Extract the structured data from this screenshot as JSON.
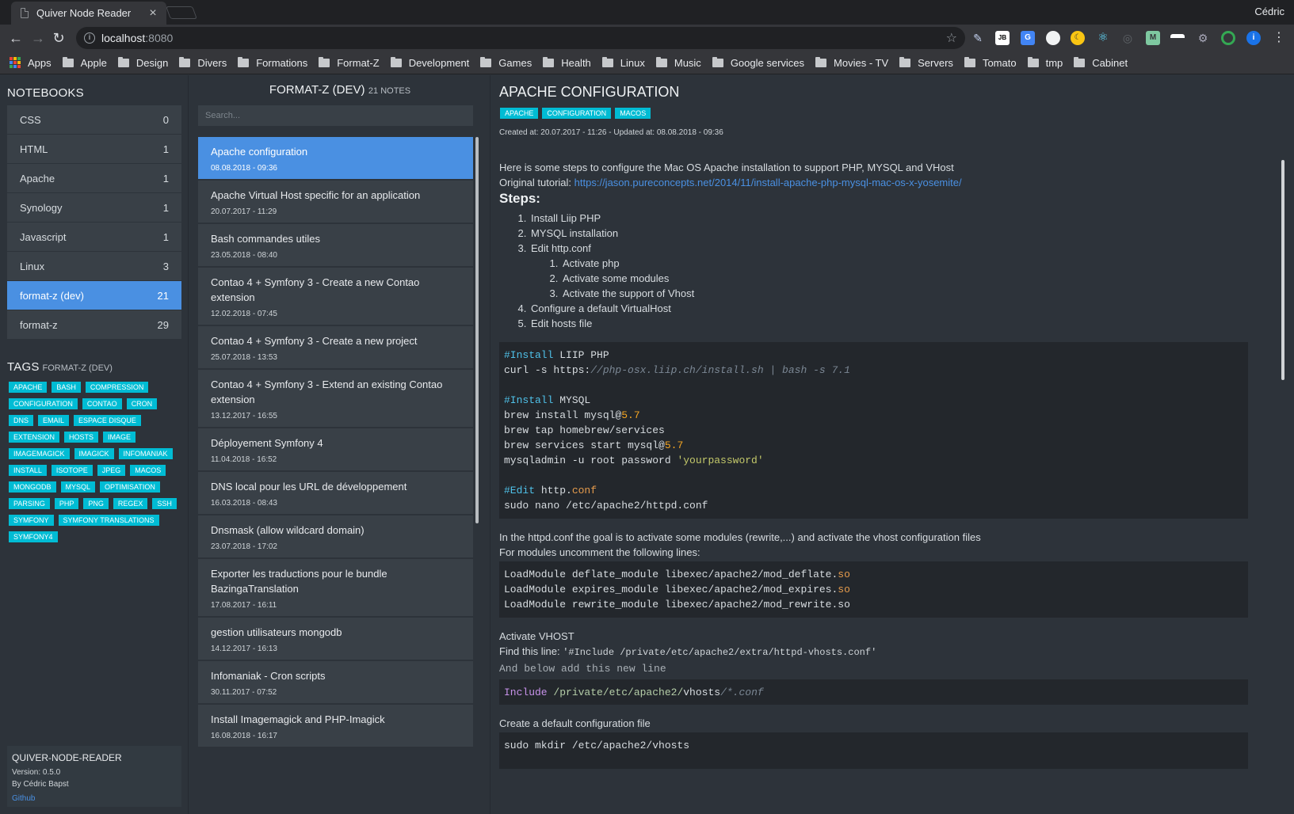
{
  "browser": {
    "tab_title": "Quiver Node Reader",
    "tab_close": "×",
    "profile": "Cédric",
    "url_host": "localhost",
    "url_port": ":8080",
    "bookmarks": [
      "Apps",
      "Apple",
      "Design",
      "Divers",
      "Formations",
      "Format-Z",
      "Development",
      "Games",
      "Health",
      "Linux",
      "Music",
      "Google services",
      "Movies - TV",
      "Servers",
      "Tomato",
      "tmp",
      "Cabinet"
    ],
    "extension_icons": [
      "brush-icon",
      "jetbrains-icon",
      "translate-icon",
      "circle-icon",
      "moon-icon",
      "react-icon",
      "disabled-icon",
      "mail-icon",
      "flag-icon",
      "puzzle-icon",
      "target-icon",
      "password-icon"
    ]
  },
  "sidebar": {
    "notebooks_title": "NOTEBOOKS",
    "notebooks": [
      {
        "label": "CSS",
        "count": "0"
      },
      {
        "label": "HTML",
        "count": "1"
      },
      {
        "label": "Apache",
        "count": "1"
      },
      {
        "label": "Synology",
        "count": "1"
      },
      {
        "label": "Javascript",
        "count": "1"
      },
      {
        "label": "Linux",
        "count": "3"
      },
      {
        "label": "format-z (dev)",
        "count": "21"
      },
      {
        "label": "format-z",
        "count": "29"
      }
    ],
    "active_notebook": "format-z (dev)",
    "tags_title": "TAGS",
    "tags_sub": "FORMAT-Z (DEV)",
    "tags": [
      "APACHE",
      "BASH",
      "COMPRESSION",
      "CONFIGURATION",
      "CONTAO",
      "CRON",
      "DNS",
      "EMAIL",
      "ESPACE DISQUE",
      "EXTENSION",
      "HOSTS",
      "IMAGE",
      "IMAGEMAGICK",
      "IMAGICK",
      "INFOMANIAK",
      "INSTALL",
      "ISOTOPE",
      "JPEG",
      "MACOS",
      "MONGODB",
      "MYSQL",
      "OPTIMISATION",
      "PARSING",
      "PHP",
      "PNG",
      "REGEX",
      "SSH",
      "SYMFONY",
      "SYMFONY TRANSLATIONS",
      "SYMFONY4"
    ],
    "about": {
      "title": "QUIVER-NODE-READER",
      "version": "Version: 0.5.0",
      "author": "By Cédric Bapst",
      "link": "Github"
    }
  },
  "notes_panel": {
    "title": "FORMAT-Z (DEV)",
    "count": "21 NOTES",
    "search_placeholder": "Search...",
    "notes": [
      {
        "title": "Apache configuration",
        "date": "08.08.2018 - 09:36"
      },
      {
        "title": "Apache Virtual Host specific for an application",
        "date": "20.07.2017 - 11:29"
      },
      {
        "title": "Bash commandes utiles",
        "date": "23.05.2018 - 08:40"
      },
      {
        "title": "Contao 4 + Symfony 3 - Create a new Contao extension",
        "date": "12.02.2018 - 07:45"
      },
      {
        "title": "Contao 4 + Symfony 3 - Create a new project",
        "date": "25.07.2018 - 13:53"
      },
      {
        "title": "Contao 4 + Symfony 3 - Extend an existing Contao extension",
        "date": "13.12.2017 - 16:55"
      },
      {
        "title": "Déployement Symfony 4",
        "date": "11.04.2018 - 16:52"
      },
      {
        "title": "DNS local pour les URL de développement",
        "date": "16.03.2018 - 08:43"
      },
      {
        "title": "Dnsmask (allow wildcard domain)",
        "date": "23.07.2018 - 17:02"
      },
      {
        "title": "Exporter les traductions pour le bundle BazingaTranslation",
        "date": "17.08.2017 - 16:11"
      },
      {
        "title": "gestion utilisateurs mongodb",
        "date": "14.12.2017 - 16:13"
      },
      {
        "title": "Infomaniak - Cron scripts",
        "date": "30.11.2017 - 07:52"
      },
      {
        "title": "Install Imagemagick and PHP-Imagick",
        "date": "16.08.2018 - 16:17"
      }
    ]
  },
  "document": {
    "title": "APACHE CONFIGURATION",
    "tags": [
      "APACHE",
      "CONFIGURATION",
      "MACOS"
    ],
    "meta": "Created at: 20.07.2017 - 11:26 - Updated at: 08.08.2018 - 09:36",
    "intro": "Here is some steps to configure the Mac OS Apache installation to support PHP, MYSQL and VHost",
    "tutorial_label": "Original tutorial: ",
    "tutorial_url": "https://jason.pureconcepts.net/2014/11/install-apache-php-mysql-mac-os-x-yosemite/",
    "steps_heading": "Steps:",
    "steps": [
      "Install Liip PHP",
      "MYSQL installation",
      "Edit http.conf",
      "Configure a default VirtualHost",
      "Edit hosts file"
    ],
    "substeps": [
      "Activate php",
      "Activate some modules",
      "Activate the support of Vhost"
    ],
    "code1": {
      "l1a": "#Install",
      "l1b": " LIIP PHP",
      "l2a": "curl -s https:",
      "l2b": "//php-osx.liip.ch/install.sh | bash -s 7.1",
      "l3a": "#Install",
      "l3b": " MYSQL",
      "l4a": "brew install mysql@",
      "l4b": "5.7",
      "l5": "brew tap homebrew/services",
      "l6a": "brew services start mysql@",
      "l6b": "5.7",
      "l7a": "mysqladmin -u root password ",
      "l7b": "'yourpassword'",
      "l8a": "#Edit",
      "l8b": " http.",
      "l8c": "conf",
      "l9": "sudo nano /etc/apache2/httpd.conf"
    },
    "para2": "In the httpd.conf the goal is to activate some modules (rewrite,...) and activate the vhost configuration files",
    "para3": "For modules uncomment the following lines:",
    "code2": {
      "l1a": "LoadModule deflate_module libexec/apache2/mod_deflate.",
      "l1b": "so",
      "l2a": "LoadModule expires_module libexec/apache2/mod_expires.",
      "l2b": "so",
      "l3": "LoadModule rewrite_module libexec/apache2/mod_rewrite.so"
    },
    "vhost_heading": "Activate VHOST",
    "find_label": "Find this line: ",
    "find_code": "'#Include /private/etc/apache2/extra/httpd-vhosts.conf'",
    "below_text": "And below add this new line",
    "code3": {
      "a": "Include",
      "b": " /private/",
      "c": "etc",
      "d": "/apache2/",
      "e": "vhosts",
      "f": "/*.conf"
    },
    "para4": "Create a default configuration file",
    "code4": "sudo mkdir /etc/apache2/vhosts"
  },
  "colors": {
    "accent": "#4a90e2",
    "tag": "#00bcd4",
    "panel": "#394047",
    "background": "#2d333a"
  }
}
